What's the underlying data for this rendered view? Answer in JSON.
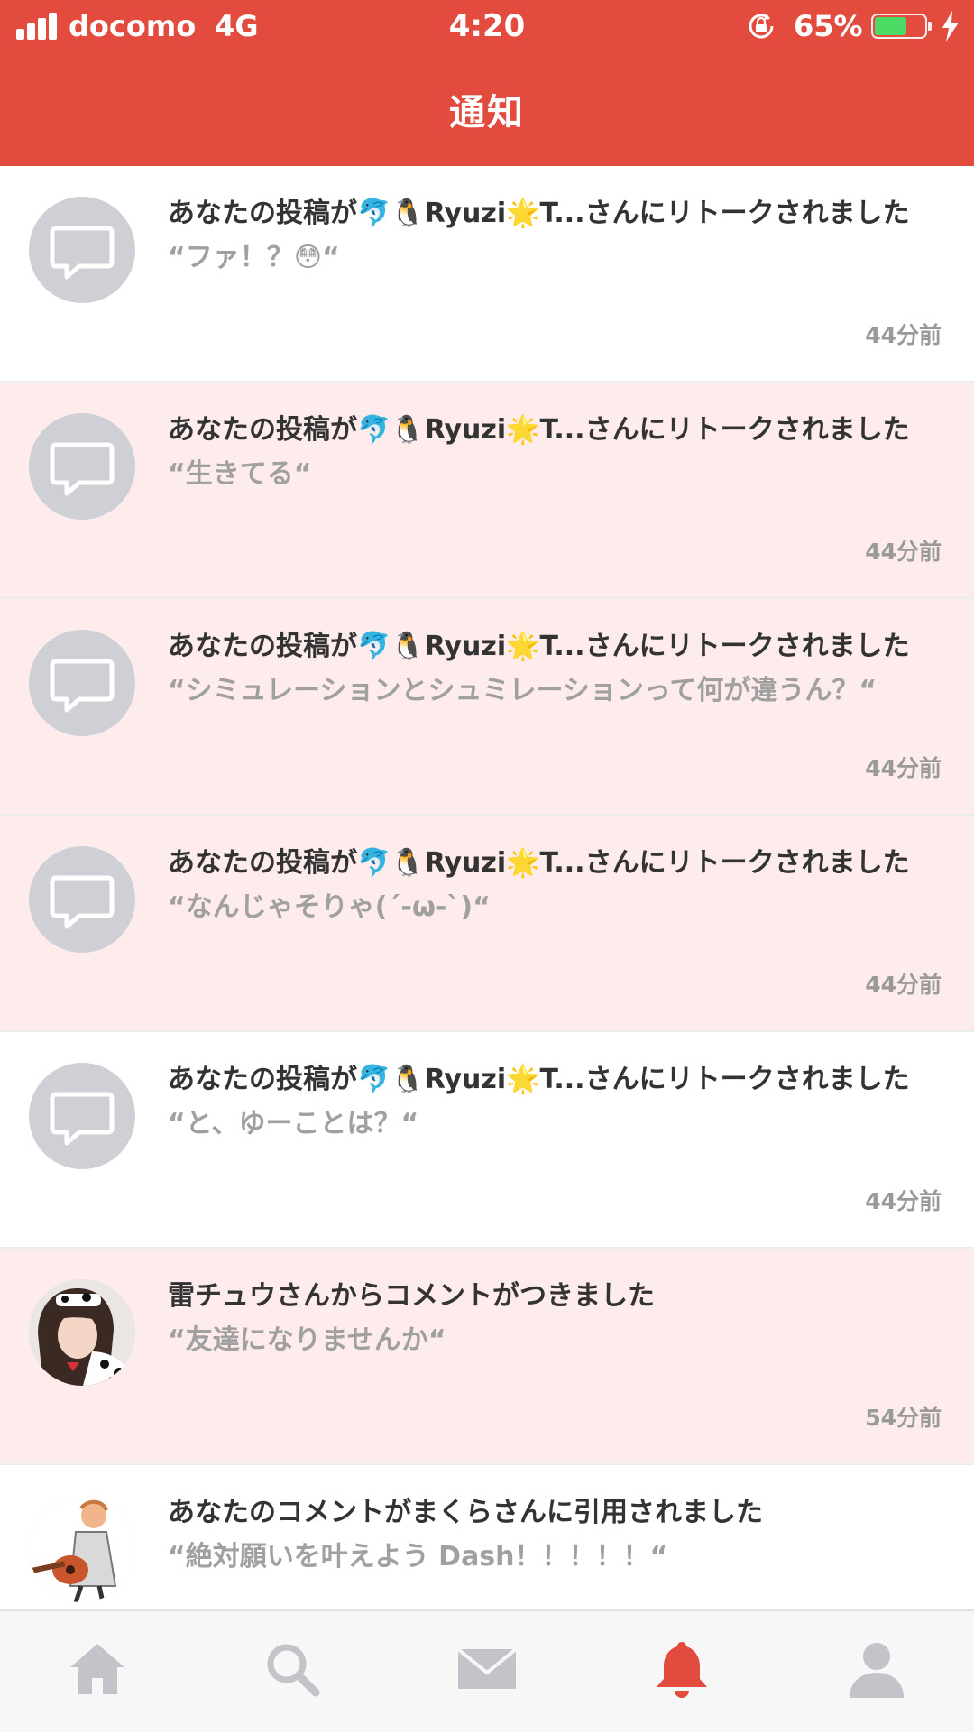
{
  "status_bar": {
    "carrier": "docomo",
    "network": "4G",
    "time": "4:20",
    "battery_percent": "65%",
    "battery_level": 0.65,
    "battery_color": "#4cd964"
  },
  "header": {
    "title": "通知",
    "background_color": "#e24b3d"
  },
  "notifications": [
    {
      "message": "あなたの投稿が🐬🐧Ryuzi🌟T...さんにリトークされました",
      "quote": "“ファ！？😳“",
      "time": "44分前",
      "avatar": "speech-bubble-icon",
      "highlighted": false
    },
    {
      "message": "あなたの投稿が🐬🐧Ryuzi🌟T...さんにリトークされました",
      "quote": "“生きてる“",
      "time": "44分前",
      "avatar": "speech-bubble-icon",
      "highlighted": true
    },
    {
      "message": "あなたの投稿が🐬🐧Ryuzi🌟T...さんにリトークされました",
      "quote": "“シミュレーションとシュミレーションって何が違うん？“",
      "time": "44分前",
      "avatar": "speech-bubble-icon",
      "highlighted": true
    },
    {
      "message": "あなたの投稿が🐬🐧Ryuzi🌟T...さんにリトークされました",
      "quote": "“なんじゃそりゃ(´-ω-`)“",
      "time": "44分前",
      "avatar": "speech-bubble-icon",
      "highlighted": true
    },
    {
      "message": "あなたの投稿が🐬🐧Ryuzi🌟T...さんにリトークされました",
      "quote": "“と、ゆーことは？“",
      "time": "44分前",
      "avatar": "speech-bubble-icon",
      "highlighted": false
    },
    {
      "message": "雷チュウさんからコメントがつきました",
      "quote": "“友達になりませんか“",
      "time": "54分前",
      "avatar": "user-photo-avatar",
      "highlighted": true
    },
    {
      "message": "あなたのコメントがまくらさんに引用されました",
      "quote": "“絶対願いを叶えよう Dash！！！！！“",
      "time": "",
      "avatar": "guitar-illustration-avatar",
      "highlighted": false
    }
  ],
  "tab_bar": {
    "tabs": [
      {
        "icon": "home-icon",
        "active": false
      },
      {
        "icon": "search-icon",
        "active": false
      },
      {
        "icon": "mail-icon",
        "active": false
      },
      {
        "icon": "bell-icon",
        "active": true
      },
      {
        "icon": "profile-icon",
        "active": false
      }
    ],
    "active_color": "#e24b3d",
    "inactive_color": "#c2c4ca"
  }
}
